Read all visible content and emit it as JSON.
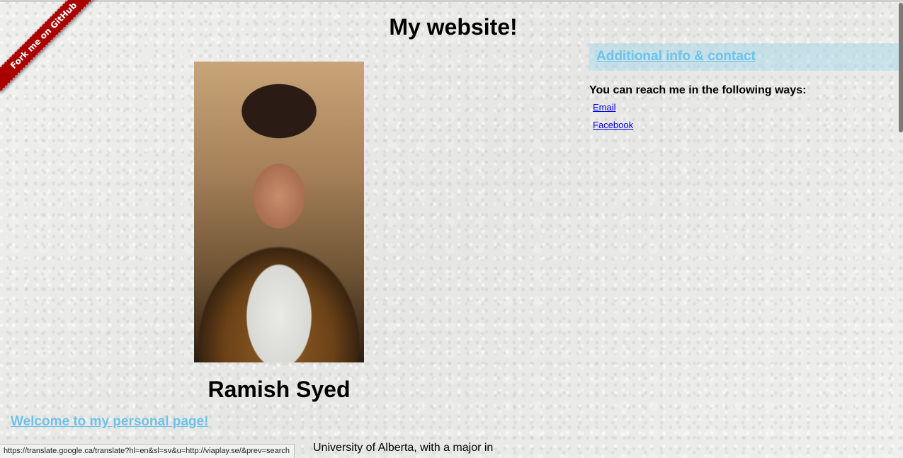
{
  "header": {
    "title": "My website!"
  },
  "ribbon": {
    "label": "Fork me on GitHub"
  },
  "profile": {
    "name": "Ramish Syed"
  },
  "welcome": {
    "heading": "Welcome to my personal page!",
    "text_visible": "University of Alberta, with a major in"
  },
  "contact": {
    "heading": "Additional info & contact",
    "intro": "You can reach me in the following ways:",
    "links": [
      {
        "label": "Email"
      },
      {
        "label": "Facebook"
      }
    ]
  },
  "status_bar": {
    "url": "https://translate.google.ca/translate?hl=en&sl=sv&u=http://viaplay.se/&prev=search"
  },
  "colors": {
    "link_heading": "#6ec3ea",
    "heading_bg": "#9fd6ec",
    "ribbon": "#aa0000",
    "link": "#0000ee"
  }
}
